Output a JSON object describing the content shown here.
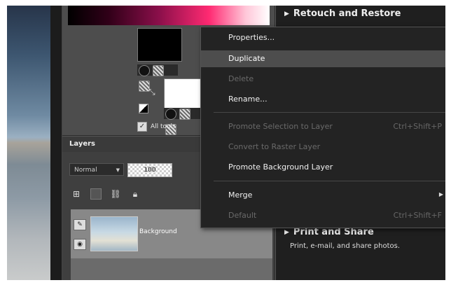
{
  "materials": {
    "all_tools_label": "All tools"
  },
  "layers": {
    "title": "Layers",
    "blend_mode": "Normal",
    "opacity": "100",
    "layer_name": "Background"
  },
  "context_menu": {
    "items": [
      {
        "label": "Properties...",
        "shortcut": "",
        "state": "enabled"
      },
      {
        "label": "Duplicate",
        "shortcut": "",
        "state": "highlighted"
      },
      {
        "label": "Delete",
        "shortcut": "",
        "state": "disabled"
      },
      {
        "label": "Rename...",
        "shortcut": "",
        "state": "enabled"
      },
      {
        "label": "Promote Selection to Layer",
        "shortcut": "Ctrl+Shift+P",
        "state": "disabled"
      },
      {
        "label": "Convert to Raster Layer",
        "shortcut": "",
        "state": "disabled"
      },
      {
        "label": "Promote Background Layer",
        "shortcut": "",
        "state": "enabled"
      },
      {
        "label": "Merge",
        "shortcut": "",
        "state": "enabled",
        "submenu": true
      },
      {
        "label": "Default",
        "shortcut": "Ctrl+Shift+F",
        "state": "disabled"
      }
    ]
  },
  "right_panel": {
    "retouch_title": "Retouch and Restore",
    "print_title": "Print and Share",
    "print_desc": "Print, e-mail, and share photos."
  },
  "colors": {
    "menu_bg": "#232323",
    "menu_highlight": "#4d4d4d",
    "panel_bg": "#4d4d4d",
    "disabled_text": "#6a6a6a"
  }
}
